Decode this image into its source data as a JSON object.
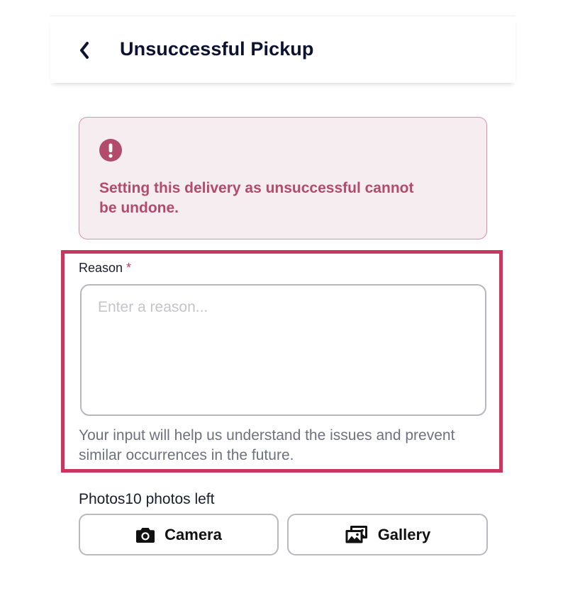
{
  "header": {
    "title": "Unsuccessful Pickup",
    "back_icon": "chevron-left-icon"
  },
  "warning": {
    "icon": "exclamation-circle-icon",
    "message": "Setting this delivery as unsuccessful cannot be undone.",
    "color": "#b34b6d",
    "background": "#f6edf0"
  },
  "reason": {
    "label": "Reason",
    "required_marker": "*",
    "placeholder": "Enter a reason...",
    "value": "",
    "help_text": "Your input will help us understand the issues and prevent similar occurrences in the future.",
    "highlight_color": "#cc3560"
  },
  "photos": {
    "label": "Photos10 photos left",
    "camera_label": "Camera",
    "camera_icon": "camera-icon",
    "gallery_label": "Gallery",
    "gallery_icon": "gallery-icon"
  }
}
